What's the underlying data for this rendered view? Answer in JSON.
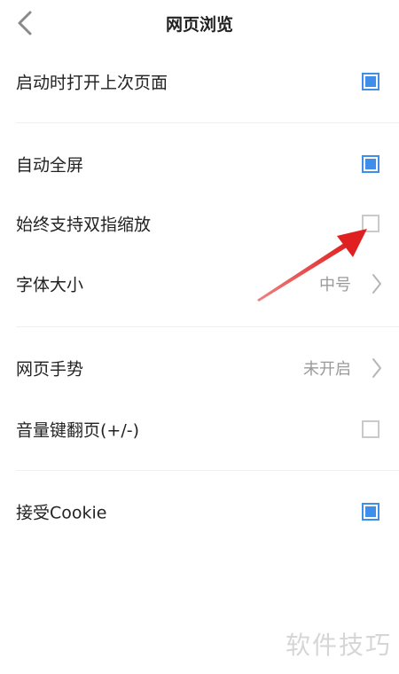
{
  "header": {
    "title": "网页浏览"
  },
  "settings": [
    {
      "label": "启动时打开上次页面",
      "type": "checkbox",
      "checked": true
    },
    {
      "label": "自动全屏",
      "type": "checkbox",
      "checked": true
    },
    {
      "label": "始终支持双指缩放",
      "type": "checkbox",
      "checked": false
    },
    {
      "label": "字体大小",
      "type": "select",
      "value": "中号"
    },
    {
      "label": "网页手势",
      "type": "select",
      "value": "未开启"
    },
    {
      "label": "音量键翻页(+/-)",
      "type": "checkbox",
      "checked": false
    },
    {
      "label": "接受Cookie",
      "type": "checkbox",
      "checked": true
    }
  ],
  "watermark": "软件技巧",
  "colors": {
    "accent": "#3f8ee9",
    "annotation_arrow": "#e02020"
  }
}
